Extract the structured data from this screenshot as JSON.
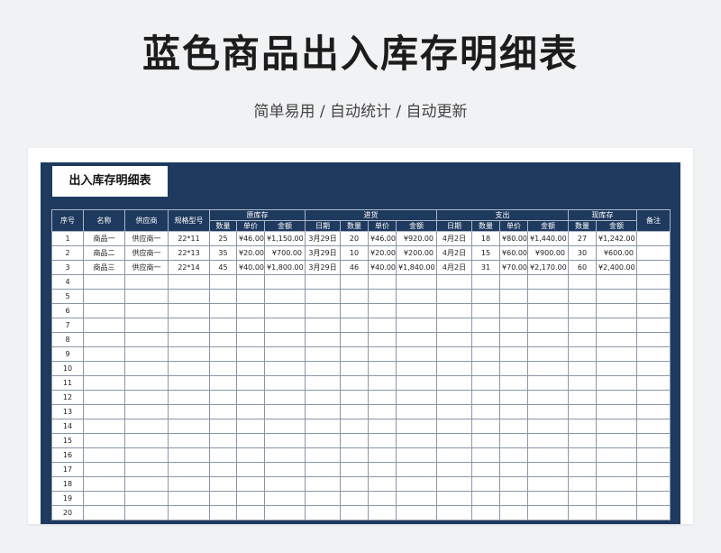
{
  "page": {
    "title": "蓝色商品出入库存明细表",
    "subtitle": "简单易用 / 自动统计 / 自动更新"
  },
  "sheet": {
    "title": "出入库存明细表",
    "header_groups": {
      "opening": "原库存",
      "incoming": "进货",
      "outgoing": "支出",
      "current": "现库存"
    },
    "headers": {
      "seq": "序号",
      "name": "名称",
      "supplier": "供应商",
      "spec": "规格型号",
      "remark": "备注",
      "open_qty": "数量",
      "open_price": "单价",
      "open_amount": "金额",
      "in_date": "日期",
      "in_qty": "数量",
      "in_price": "单价",
      "in_amount": "金额",
      "out_date": "日期",
      "out_qty": "数量",
      "out_price": "单价",
      "out_amount": "金额",
      "cur_qty": "数量",
      "cur_amount": "金额"
    },
    "rows": [
      {
        "seq": "1",
        "name": "商品一",
        "supplier": "供应商一",
        "spec": "22*11",
        "open_qty": "25",
        "open_price": "¥46.00",
        "open_amount": "¥1,150.00",
        "in_date": "3月29日",
        "in_qty": "20",
        "in_price": "¥46.00",
        "in_amount": "¥920.00",
        "out_date": "4月2日",
        "out_qty": "18",
        "out_price": "¥80.00",
        "out_amount": "¥1,440.00",
        "cur_qty": "27",
        "cur_amount": "¥1,242.00",
        "remark": ""
      },
      {
        "seq": "2",
        "name": "商品二",
        "supplier": "供应商一",
        "spec": "22*13",
        "open_qty": "35",
        "open_price": "¥20.00",
        "open_amount": "¥700.00",
        "in_date": "3月29日",
        "in_qty": "10",
        "in_price": "¥20.00",
        "in_amount": "¥200.00",
        "out_date": "4月2日",
        "out_qty": "15",
        "out_price": "¥60.00",
        "out_amount": "¥900.00",
        "cur_qty": "30",
        "cur_amount": "¥600.00",
        "remark": ""
      },
      {
        "seq": "3",
        "name": "商品三",
        "supplier": "供应商一",
        "spec": "22*14",
        "open_qty": "45",
        "open_price": "¥40.00",
        "open_amount": "¥1,800.00",
        "in_date": "3月29日",
        "in_qty": "46",
        "in_price": "¥40.00",
        "in_amount": "¥1,840.00",
        "out_date": "4月2日",
        "out_qty": "31",
        "out_price": "¥70.00",
        "out_amount": "¥2,170.00",
        "cur_qty": "60",
        "cur_amount": "¥2,400.00",
        "remark": ""
      },
      {
        "seq": "4"
      },
      {
        "seq": "5"
      },
      {
        "seq": "6"
      },
      {
        "seq": "7"
      },
      {
        "seq": "8"
      },
      {
        "seq": "9"
      },
      {
        "seq": "10"
      },
      {
        "seq": "11"
      },
      {
        "seq": "12"
      },
      {
        "seq": "13"
      },
      {
        "seq": "14"
      },
      {
        "seq": "15"
      },
      {
        "seq": "16"
      },
      {
        "seq": "17"
      },
      {
        "seq": "18"
      },
      {
        "seq": "19"
      },
      {
        "seq": "20"
      }
    ],
    "colors": {
      "sheet_background": "#1f3a5f",
      "cell_background": "#ffffff"
    }
  }
}
